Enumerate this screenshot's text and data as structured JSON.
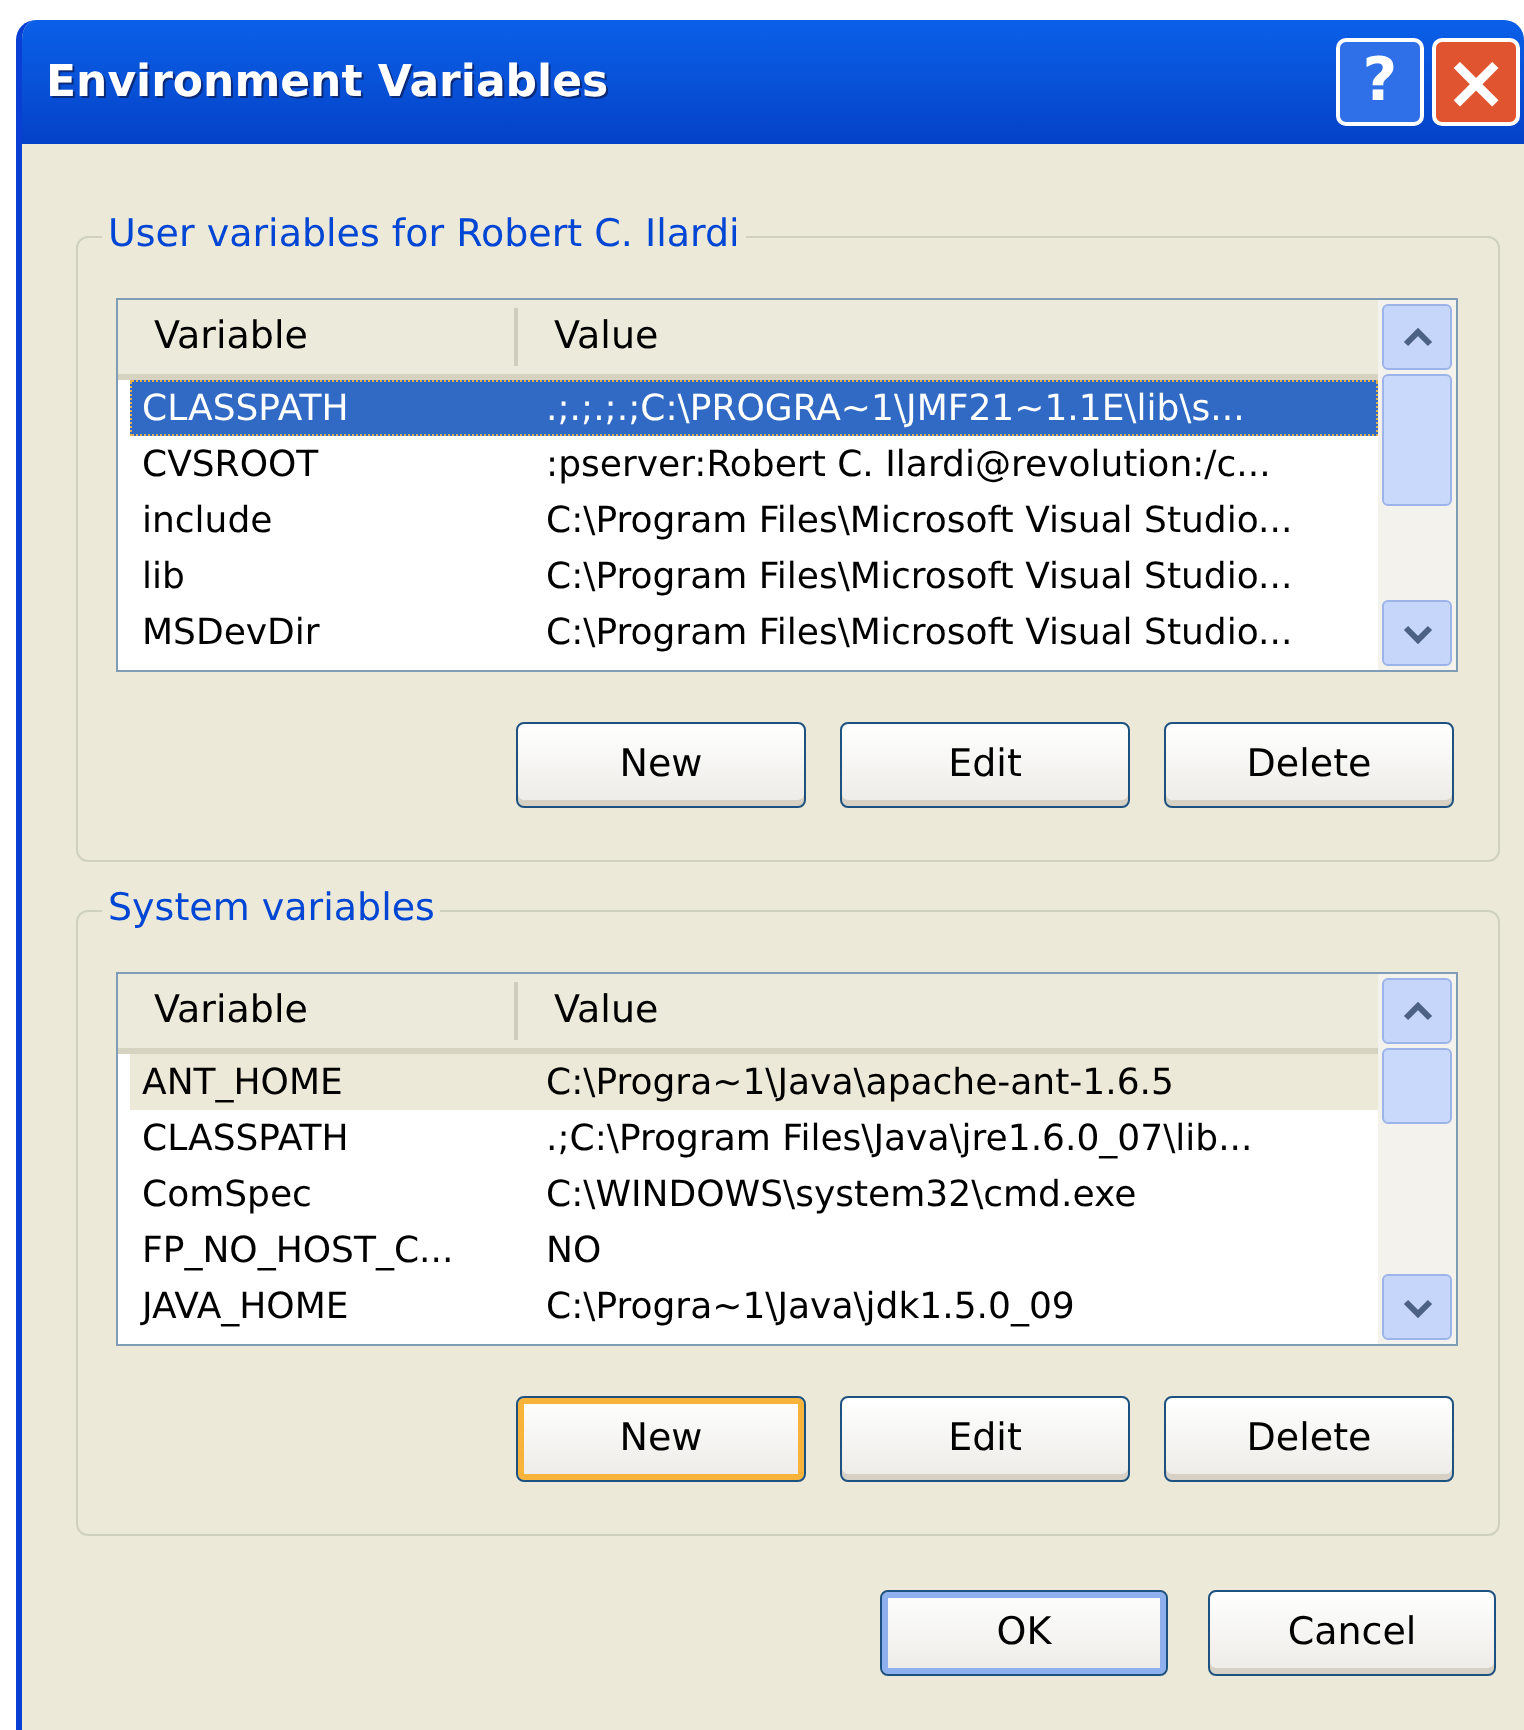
{
  "window": {
    "title": "Environment Variables"
  },
  "title_buttons": [
    {
      "kind": "help",
      "label": "?"
    },
    {
      "kind": "close",
      "label": "×"
    }
  ],
  "groups": [
    {
      "title": "User variables for Robert C. Ilardi",
      "focused": true,
      "columns": [
        "Variable",
        "Value"
      ],
      "rows": [
        {
          "variable": "CLASSPATH",
          "value": ".;.;.;.;C:\\PROGRA~1\\JMF21~1.1E\\lib\\s...",
          "selected": true
        },
        {
          "variable": "CVSROOT",
          "value": ":pserver:Robert C. Ilardi@revolution:/c...",
          "selected": false
        },
        {
          "variable": "include",
          "value": "C:\\Program Files\\Microsoft Visual Studio...",
          "selected": false
        },
        {
          "variable": "lib",
          "value": "C:\\Program Files\\Microsoft Visual Studio...",
          "selected": false
        },
        {
          "variable": "MSDevDir",
          "value": "C:\\Program Files\\Microsoft Visual Studio...",
          "selected": false
        }
      ],
      "buttons": [
        {
          "label": "New",
          "hot": false
        },
        {
          "label": "Edit",
          "hot": false
        },
        {
          "label": "Delete",
          "hot": false
        }
      ]
    },
    {
      "title": "System variables",
      "focused": false,
      "columns": [
        "Variable",
        "Value"
      ],
      "rows": [
        {
          "variable": "ANT_HOME",
          "value": "C:\\Progra~1\\Java\\apache-ant-1.6.5",
          "selected": true
        },
        {
          "variable": "CLASSPATH",
          "value": ".;C:\\Program Files\\Java\\jre1.6.0_07\\lib...",
          "selected": false
        },
        {
          "variable": "ComSpec",
          "value": "C:\\WINDOWS\\system32\\cmd.exe",
          "selected": false
        },
        {
          "variable": "FP_NO_HOST_C...",
          "value": "NO",
          "selected": false
        },
        {
          "variable": "JAVA_HOME",
          "value": "C:\\Progra~1\\Java\\jdk1.5.0_09",
          "selected": false
        }
      ],
      "buttons": [
        {
          "label": "New",
          "hot": true
        },
        {
          "label": "Edit",
          "hot": false
        },
        {
          "label": "Delete",
          "hot": false
        }
      ]
    }
  ],
  "dialog_buttons": [
    {
      "label": "OK",
      "default": true
    },
    {
      "label": "Cancel",
      "default": false
    }
  ]
}
